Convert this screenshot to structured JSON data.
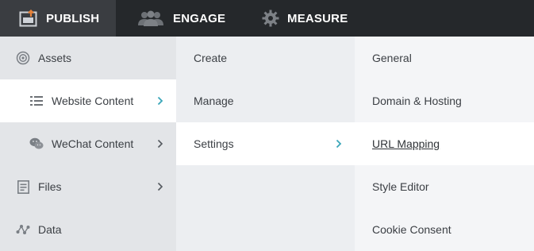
{
  "topnav": {
    "tabs": [
      {
        "label": "PUBLISH",
        "icon": "publish-icon"
      },
      {
        "label": "ENGAGE",
        "icon": "people-icon"
      },
      {
        "label": "MEASURE",
        "icon": "gear-icon"
      }
    ]
  },
  "menu1": {
    "items": [
      {
        "label": "Assets",
        "icon": "assets-target-icon"
      },
      {
        "label": "Website Content",
        "icon": "list-icon"
      },
      {
        "label": "WeChat Content",
        "icon": "wechat-icon"
      },
      {
        "label": "Files",
        "icon": "file-icon"
      },
      {
        "label": "Data",
        "icon": "data-nodes-icon"
      }
    ]
  },
  "menu2": {
    "items": [
      {
        "label": "Create"
      },
      {
        "label": "Manage"
      },
      {
        "label": "Settings"
      }
    ]
  },
  "menu3": {
    "items": [
      {
        "label": "General"
      },
      {
        "label": "Domain & Hosting"
      },
      {
        "label": "URL Mapping"
      },
      {
        "label": "Style Editor"
      },
      {
        "label": "Cookie Consent"
      }
    ]
  },
  "colors": {
    "topnav_bg": "#25282b",
    "topnav_active_bg": "#3a3d41",
    "accent_chevron": "#3aa6b9",
    "publish_accent": "#e8833a"
  }
}
